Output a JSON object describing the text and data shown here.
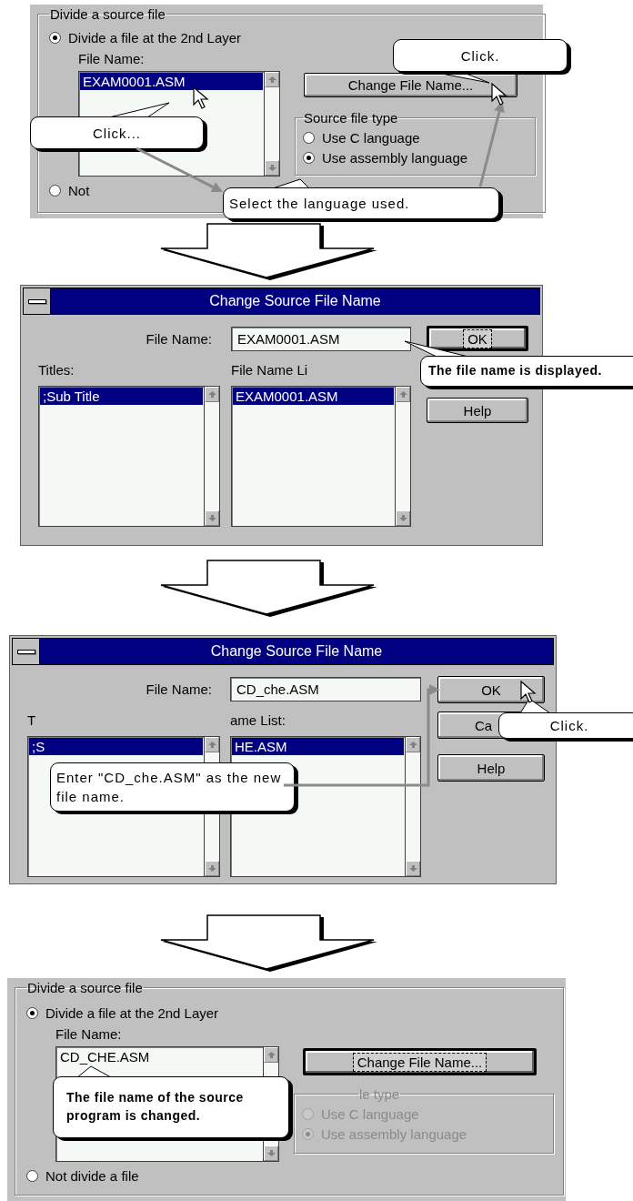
{
  "steps": [
    {
      "kind": "group_panel",
      "legend": "Divide a source file",
      "layer_option": {
        "label": "Divide a file at the 2nd Layer",
        "selected": true
      },
      "file_name_label": "File Name:",
      "file_list": [
        {
          "text": "EXAM0001.ASM",
          "selected": true
        }
      ],
      "change_button": {
        "label": "Change File Name...",
        "focused": false
      },
      "source_type": {
        "legend": "Source file type",
        "disabled": false,
        "options": [
          {
            "label": "Use C language",
            "selected": false
          },
          {
            "label": "Use assembly language",
            "selected": true
          }
        ]
      },
      "other_option": {
        "label": "Not",
        "selected": false
      },
      "callouts": [
        {
          "text": "Click.",
          "bold": false
        },
        {
          "text": "Click...",
          "bold": false
        },
        {
          "text": "Select the language used.",
          "bold": false
        }
      ]
    },
    {
      "kind": "dialog",
      "title": "Change Source File Name",
      "file_name_label": "File Name:",
      "file_name_value": "EXAM0001.ASM",
      "titles_label": "Titles:",
      "list_label": "File Name Li",
      "titles": [
        {
          "text": ";Sub Title",
          "selected": true
        }
      ],
      "file_list": [
        {
          "text": "EXAM0001.ASM",
          "selected": true
        }
      ],
      "buttons": [
        {
          "label": "OK",
          "focused": true
        },
        {
          "label": "Help",
          "focused": false
        }
      ],
      "callouts": [
        {
          "text": "The file name is displayed.",
          "bold": true
        }
      ]
    },
    {
      "kind": "dialog",
      "title": "Change Source File Name",
      "file_name_label": "File Name:",
      "file_name_value": "CD_che.ASM",
      "titles_label": "T",
      "list_label": "ame List:",
      "titles": [
        {
          "text": ";S",
          "selected": true
        }
      ],
      "file_list": [
        {
          "text": "HE.ASM",
          "selected": true
        }
      ],
      "buttons": [
        {
          "label": "OK",
          "focused": false
        },
        {
          "label": "Ca",
          "focused": false
        },
        {
          "label": "Help",
          "focused": false
        }
      ],
      "callouts": [
        {
          "text": "Enter \"CD_che.ASM\" as the new file name.",
          "bold": false
        },
        {
          "text": "Click.",
          "bold": false
        }
      ]
    },
    {
      "kind": "group_panel",
      "legend": "Divide a source file",
      "layer_option": {
        "label": "Divide a file at the 2nd Layer",
        "selected": true
      },
      "file_name_label": "File Name:",
      "file_list": [
        {
          "text": "CD_CHE.ASM",
          "selected": false
        }
      ],
      "change_button": {
        "label": "Change File Name...",
        "focused": true
      },
      "source_type": {
        "legend": "le type",
        "disabled": true,
        "options": [
          {
            "label": "Use C language",
            "selected": false
          },
          {
            "label": "Use assembly language",
            "selected": true
          }
        ]
      },
      "other_option": {
        "label": "Not divide a file",
        "selected": false
      },
      "callouts": [
        {
          "text": "The file name of the source program is changed.",
          "bold": true
        }
      ]
    }
  ]
}
